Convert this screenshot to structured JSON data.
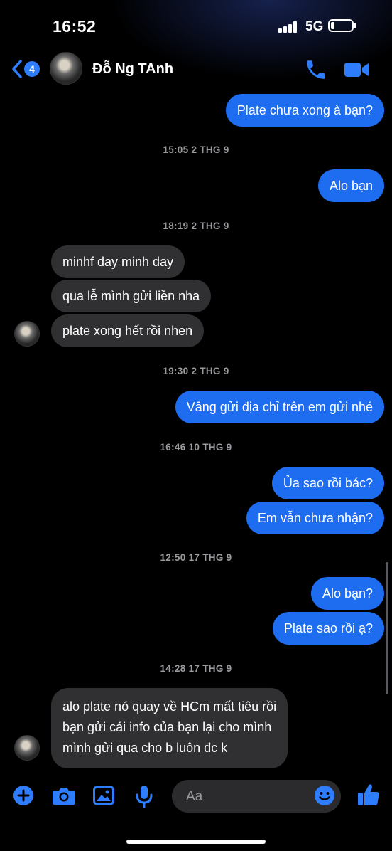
{
  "status": {
    "time": "16:52",
    "network": "5G"
  },
  "header": {
    "back_badge": "4",
    "contact_name": "Đỗ Ng TAnh"
  },
  "messages": [
    {
      "text": "Plate chưa xong à bạn?"
    },
    {
      "stamp": "15:05 2 THG 9"
    },
    {
      "text": "Alo bạn"
    },
    {
      "stamp": "18:19 2 THG 9"
    },
    {
      "text": "minhf day minh day"
    },
    {
      "text": "qua lễ mình gửi liền nha"
    },
    {
      "text": "plate xong hết rồi nhen"
    },
    {
      "stamp": "19:30 2 THG 9"
    },
    {
      "text": "Vâng gửi địa chỉ trên em gửi nhé"
    },
    {
      "stamp": "16:46 10 THG 9"
    },
    {
      "text": "Ủa sao rồi bác?"
    },
    {
      "text": "Em vẫn chưa nhận?"
    },
    {
      "stamp": "12:50 17 THG 9"
    },
    {
      "text": "Alo bạn?"
    },
    {
      "text": "Plate sao rồi ạ?"
    },
    {
      "stamp": "14:28 17 THG 9"
    },
    {
      "lines": [
        "alo plate nó quay về HCm mất tiêu rồi",
        "bạn gửi cái info của bạn lại cho mình",
        "mình gửi qua cho b luôn đc k"
      ]
    }
  ],
  "composer": {
    "placeholder": "Aa"
  },
  "colors": {
    "outgoing": "#1e6cf0",
    "incoming": "#303032",
    "accent": "#2f7dff"
  },
  "icons": [
    "chevron-left-icon",
    "phone-icon",
    "video-camera-icon",
    "plus-icon",
    "camera-icon",
    "image-icon",
    "microphone-icon",
    "emoji-icon",
    "thumbs-up-icon"
  ]
}
